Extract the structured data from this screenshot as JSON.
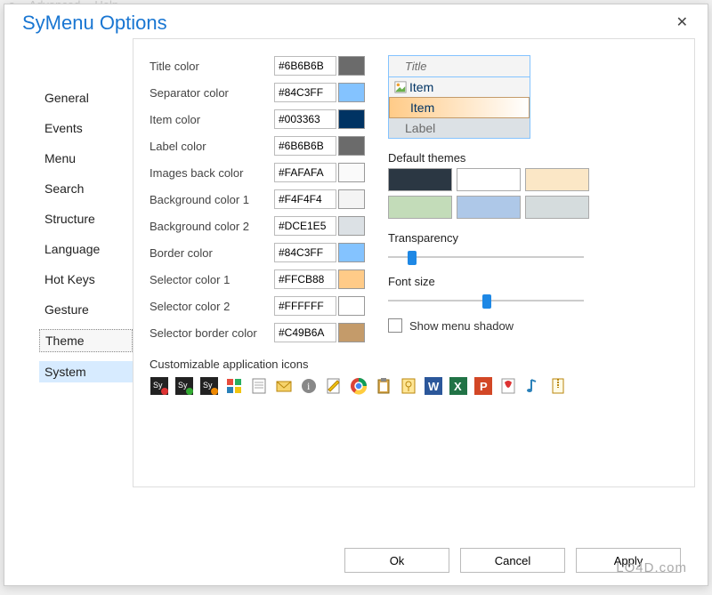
{
  "window": {
    "title": "SyMenu Options"
  },
  "sidebar": {
    "items": [
      {
        "label": "General"
      },
      {
        "label": "Events"
      },
      {
        "label": "Menu"
      },
      {
        "label": "Search"
      },
      {
        "label": "Structure"
      },
      {
        "label": "Language"
      },
      {
        "label": "Hot Keys"
      },
      {
        "label": "Gesture"
      },
      {
        "label": "Theme"
      },
      {
        "label": "System"
      }
    ],
    "selected_index": 8,
    "highlight_index": 9
  },
  "theme": {
    "title_color": {
      "label": "Title color",
      "value": "#6B6B6B"
    },
    "separator_color": {
      "label": "Separator color",
      "value": "#84C3FF"
    },
    "item_color": {
      "label": "Item color",
      "value": "#003363"
    },
    "label_color": {
      "label": "Label color",
      "value": "#6B6B6B"
    },
    "images_back_color": {
      "label": "Images back color",
      "value": "#FAFAFA"
    },
    "bg_color_1": {
      "label": "Background color 1",
      "value": "#F4F4F4"
    },
    "bg_color_2": {
      "label": "Background color 2",
      "value": "#DCE1E5"
    },
    "border_color": {
      "label": "Border color",
      "value": "#84C3FF"
    },
    "selector_color_1": {
      "label": "Selector color 1",
      "value": "#FFCB88"
    },
    "selector_color_2": {
      "label": "Selector color 2",
      "value": "#FFFFFF"
    },
    "selector_border": {
      "label": "Selector border color",
      "value": "#C49B6A"
    }
  },
  "preview": {
    "title": "Title",
    "item1": "Item",
    "item2": "Item",
    "label": "Label"
  },
  "themes": {
    "label": "Default themes",
    "swatches": [
      "#2b3743",
      "#ffffff",
      "#fbe7c6",
      "#c3dcb9",
      "#aec8e8",
      "#d5dcdd"
    ]
  },
  "transparency": {
    "label": "Transparency",
    "pct": 10
  },
  "fontsize": {
    "label": "Font size",
    "pct": 48
  },
  "shadow": {
    "label": "Show menu shadow",
    "checked": false
  },
  "icons": {
    "label": "Customizable application icons",
    "items": [
      "sy-black-red",
      "sy-black-green",
      "sy-black-orange",
      "windows-flag",
      "note",
      "envelope",
      "info-circle",
      "edit",
      "chrome",
      "clipboard",
      "key-card",
      "word",
      "excel",
      "powerpoint",
      "pdf",
      "music-note",
      "zip"
    ]
  },
  "buttons": {
    "ok": "Ok",
    "cancel": "Cancel",
    "apply": "Apply"
  },
  "watermark": "LO4D.com",
  "ghost_menu": [
    "s",
    "Advanced",
    "Help"
  ]
}
